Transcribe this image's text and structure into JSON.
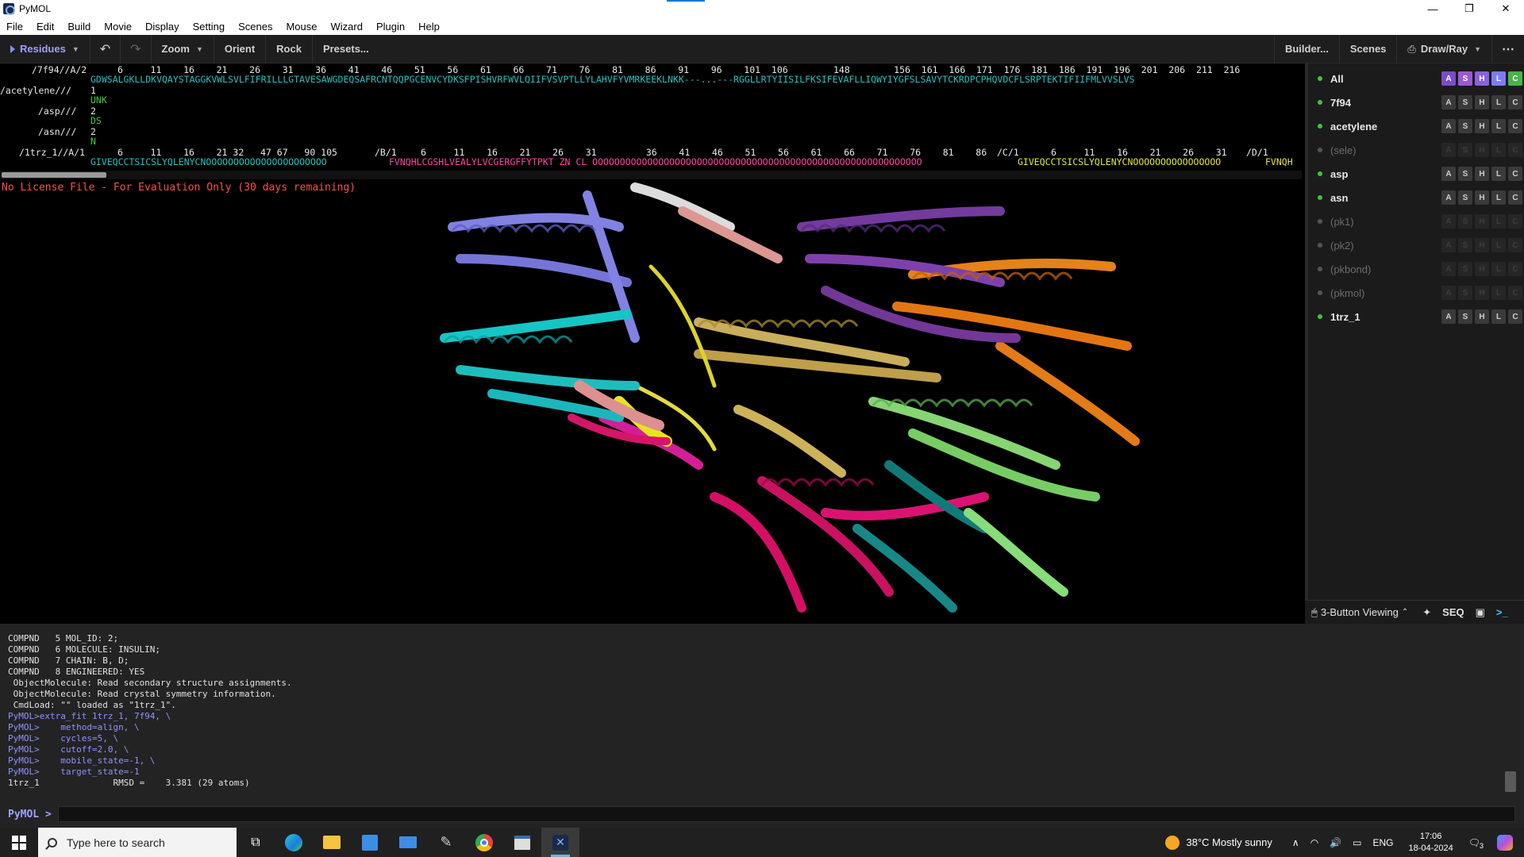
{
  "window": {
    "title": "PyMOL",
    "minimize": "—",
    "maximize": "❐",
    "close": "✕"
  },
  "menu": [
    "File",
    "Edit",
    "Build",
    "Movie",
    "Display",
    "Setting",
    "Scenes",
    "Mouse",
    "Wizard",
    "Plugin",
    "Help"
  ],
  "toolbar": {
    "residues": "Residues",
    "undo": "↶",
    "redo": "↷",
    "zoom": "Zoom",
    "orient": "Orient",
    "rock": "Rock",
    "presets": "Presets...",
    "builder": "Builder...",
    "scenes": "Scenes",
    "draw_ray": "Draw/Ray",
    "more": "⋯"
  },
  "sequence": {
    "r1_label": "/7f94//A/2",
    "r1_nums": "6     11    16    21    26    31    36    41    46    51    56    61    66    71    76    81    86    91    96    101  106",
    "r1_nums2": "148        156  161  166  171  176  181  186  191  196  201  206  211  216",
    "r1_seq": "GDWSALGKLLDKVQAYSTAGGKVWLSVLFIFRILLLGTAVESAWGDEQSAFRCNTQQPGCENVCYDKSFPISHVRFWVLQIIFVSVPTLLYLAHVFYVMRKEEKLNKK---...---RGGLLRTYIISILFKSIFEVAFLLIQWYIYGFSLSAVYTCKRDPCPHQVDCFLSRPTEKTIFIIFMLVVSLVS",
    "r2_label": "/acetylene///",
    "r2_num": "1",
    "r2_seq": "UNK",
    "r3_label": "/asp///",
    "r3_num": "2",
    "r3_seq": "DS",
    "r4_label": "/asn///",
    "r4_num": "2",
    "r4_seq": "N",
    "r5_label": "/1trz_1//A/1",
    "r5_nums_a": "6     11    16    21 32   47 67   90 105",
    "r5_b": "/B/1",
    "r5_nums_b": "6     11    16    21    26    31         36    41    46    51    56    61    66    71    76    81    86",
    "r5_c": "/C/1",
    "r5_nums_c": "6     11    16    21    26    31",
    "r5_d": "/D/1",
    "r5_seq_a": "GIVEQCCTSICSLYQLENYCNOOOOOOOOOOOOOOOOOOOOOO",
    "r5_seq_b": "FVNQHLCGSHLVEALYLVCGERGFFYTPKT ZN CL OOOOOOOOOOOOOOOOOOOOOOOOOOOOOOOOOOOOOOOOOOOOOOOOOOOOOOOOOOOO",
    "r5_seq_c": "GIVEQCCTSICSLYQLENYCNOOOOOOOOOOOOOOOO",
    "r5_seq_d": "FVNQH"
  },
  "viewport": {
    "license": "No License File - For Evaluation Only (30 days remaining)"
  },
  "objects": [
    {
      "name": "All",
      "enabled": true
    },
    {
      "name": "7f94",
      "enabled": true
    },
    {
      "name": "acetylene",
      "enabled": true
    },
    {
      "name": "(sele)",
      "enabled": false
    },
    {
      "name": "asp",
      "enabled": true
    },
    {
      "name": "asn",
      "enabled": true
    },
    {
      "name": "(pk1)",
      "enabled": false
    },
    {
      "name": "(pk2)",
      "enabled": false
    },
    {
      "name": "(pkbond)",
      "enabled": false
    },
    {
      "name": "(pkmol)",
      "enabled": false
    },
    {
      "name": "1trz_1",
      "enabled": true
    }
  ],
  "asc_buttons": [
    "A",
    "S",
    "H",
    "L",
    "C"
  ],
  "panel_bottom": {
    "mode": "3-Button Viewing",
    "seq": "SEQ"
  },
  "console": [
    {
      "t": "COMPND   5 MOL_ID: 2;",
      "p": false
    },
    {
      "t": "COMPND   6 MOLECULE: INSULIN;",
      "p": false
    },
    {
      "t": "COMPND   7 CHAIN: B, D;",
      "p": false
    },
    {
      "t": "COMPND   8 ENGINEERED: YES",
      "p": false
    },
    {
      "t": " ObjectMolecule: Read secondary structure assignments.",
      "p": false
    },
    {
      "t": " ObjectMolecule: Read crystal symmetry information.",
      "p": false
    },
    {
      "t": " CmdLoad: \"\" loaded as \"1trz_1\".",
      "p": false
    },
    {
      "t": "PyMOL>extra_fit 1trz_1, 7f94, \\",
      "p": true
    },
    {
      "t": "PyMOL>    method=align, \\",
      "p": true
    },
    {
      "t": "PyMOL>    cycles=5, \\",
      "p": true
    },
    {
      "t": "PyMOL>    cutoff=2.0, \\",
      "p": true
    },
    {
      "t": "PyMOL>    mobile_state=-1, \\",
      "p": true
    },
    {
      "t": "PyMOL>    target_state=-1",
      "p": true
    },
    {
      "t": "1trz_1              RMSD =    3.381 (29 atoms)",
      "p": false
    }
  ],
  "prompt": {
    "label": "PyMOL >"
  },
  "taskbar": {
    "search_placeholder": "Type here to search",
    "weather": "38°C  Mostly sunny",
    "lang": "ENG",
    "time": "17:06",
    "date": "18-04-2024",
    "notif": "3"
  }
}
